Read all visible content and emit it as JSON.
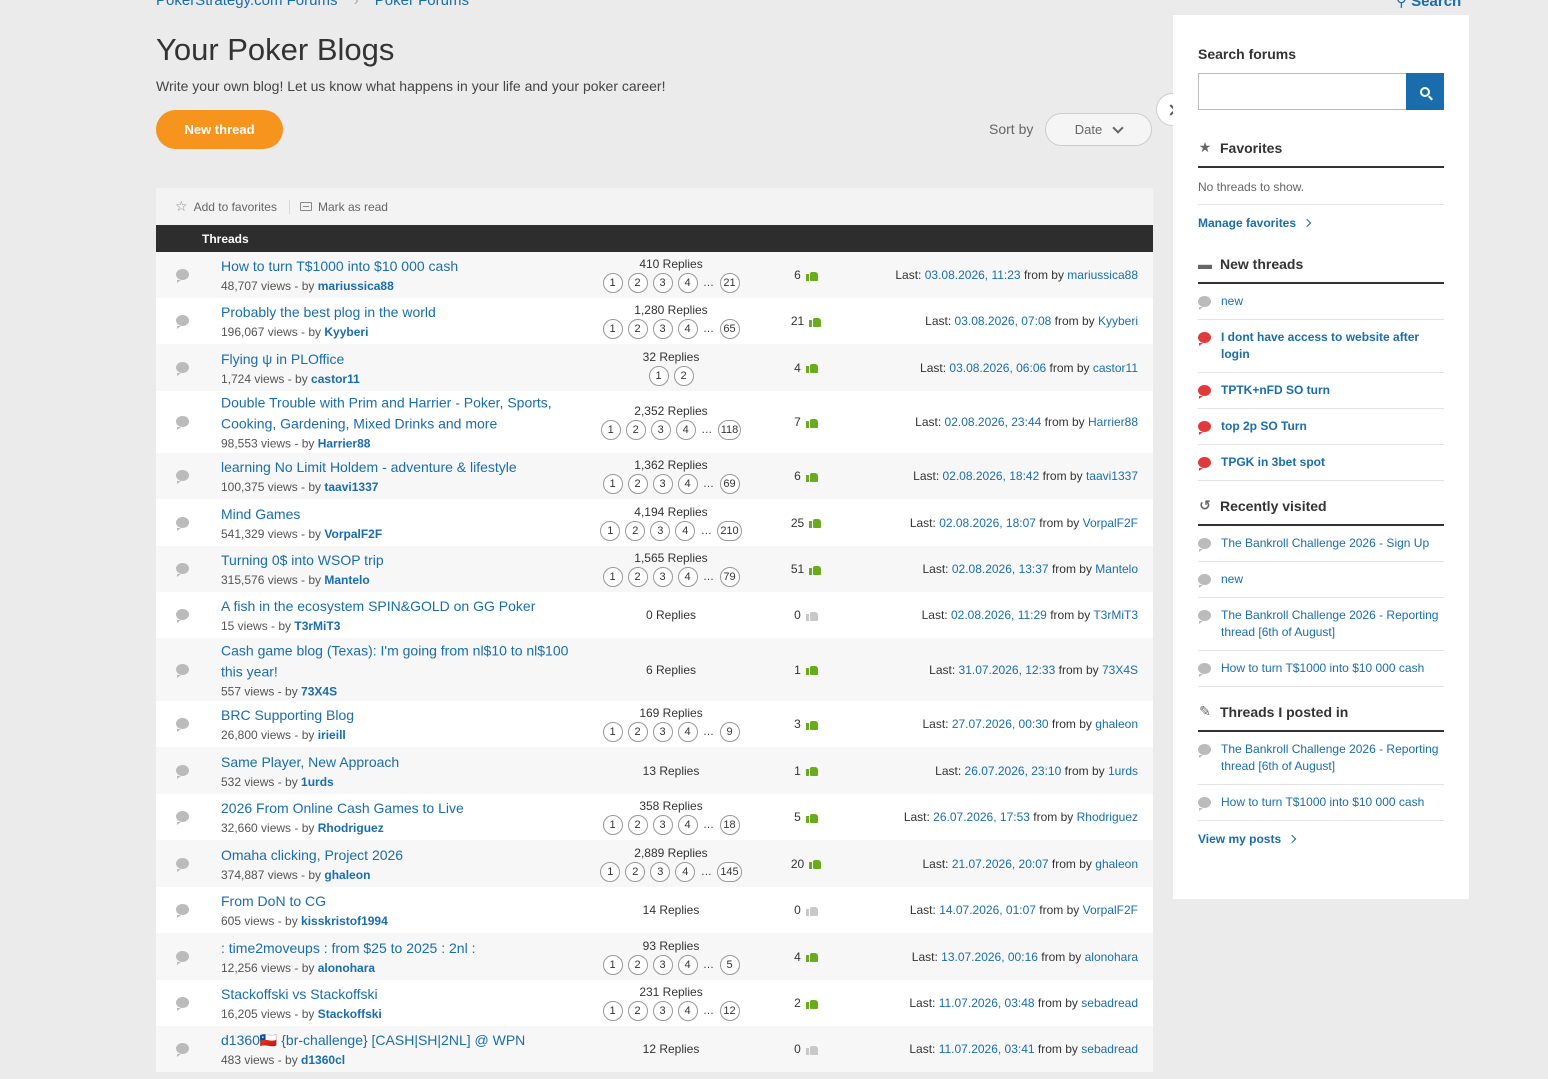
{
  "breadcrumb": [
    "PokerStrategy.com Forums",
    "Poker Forums"
  ],
  "top_search_label": "Search",
  "page": {
    "title": "Your Poker Blogs",
    "description": "Write your own blog! Let us know what happens in your life and your poker career!",
    "new_thread_label": "New thread",
    "sort_label": "Sort by",
    "sort_value": "Date"
  },
  "toolbar": {
    "add_favorites": "Add to favorites",
    "mark_read": "Mark as read"
  },
  "table": {
    "header": "Threads",
    "rows": [
      {
        "title": "How to turn T$1000 into $10 000 cash",
        "views": "48,707 views - by ",
        "author": "mariussica88",
        "replies": "410 Replies",
        "pages": [
          "1",
          "2",
          "3",
          "4",
          "21"
        ],
        "likes": "6",
        "liked": true,
        "last_prefix": "Last: ",
        "last_date": "03.08.2026, 11:23",
        "from": " from by ",
        "last_user": "mariussica88"
      },
      {
        "title": "Probably the best plog in the world",
        "views": "196,067 views - by ",
        "author": "Kyyberi",
        "replies": "1,280 Replies",
        "pages": [
          "1",
          "2",
          "3",
          "4",
          "65"
        ],
        "likes": "21",
        "liked": true,
        "last_prefix": "Last: ",
        "last_date": "03.08.2026, 07:08",
        "from": " from by ",
        "last_user": "Kyyberi"
      },
      {
        "title": "Flying ψ in PLOffice",
        "views": "1,724 views - by ",
        "author": "castor11",
        "replies": "32 Replies",
        "pages": [
          "1",
          "2"
        ],
        "likes": "4",
        "liked": true,
        "last_prefix": "Last: ",
        "last_date": "03.08.2026, 06:06",
        "from": " from by ",
        "last_user": "castor11"
      },
      {
        "title": "Double Trouble with Prim and Harrier - Poker, Sports, Cooking, Gardening, Mixed Drinks and more",
        "views": "98,553 views - by ",
        "author": "Harrier88",
        "replies": "2,352 Replies",
        "pages": [
          "1",
          "2",
          "3",
          "4",
          "118"
        ],
        "likes": "7",
        "liked": true,
        "last_prefix": "Last: ",
        "last_date": "02.08.2026, 23:44",
        "from": " from by ",
        "last_user": "Harrier88"
      },
      {
        "title": "learning No Limit Holdem - adventure & lifestyle",
        "views": "100,375 views - by ",
        "author": "taavi1337",
        "replies": "1,362 Replies",
        "pages": [
          "1",
          "2",
          "3",
          "4",
          "69"
        ],
        "likes": "6",
        "liked": true,
        "last_prefix": "Last: ",
        "last_date": "02.08.2026, 18:42",
        "from": " from by ",
        "last_user": "taavi1337"
      },
      {
        "title": "Mind Games",
        "views": "541,329 views - by ",
        "author": "VorpalF2F",
        "replies": "4,194 Replies",
        "pages": [
          "1",
          "2",
          "3",
          "4",
          "210"
        ],
        "likes": "25",
        "liked": true,
        "last_prefix": "Last: ",
        "last_date": "02.08.2026, 18:07",
        "from": " from by ",
        "last_user": "VorpalF2F"
      },
      {
        "title": "Turning 0$ into WSOP trip",
        "views": "315,576 views - by ",
        "author": "Mantelo",
        "replies": "1,565 Replies",
        "pages": [
          "1",
          "2",
          "3",
          "4",
          "79"
        ],
        "likes": "51",
        "liked": true,
        "last_prefix": "Last: ",
        "last_date": "02.08.2026, 13:37",
        "from": " from by ",
        "last_user": "Mantelo"
      },
      {
        "title": "A fish in the ecosystem SPIN&GOLD on GG Poker",
        "views": "15 views - by ",
        "author": "T3rMiT3",
        "replies": "0 Replies",
        "pages": [],
        "likes": "0",
        "liked": false,
        "last_prefix": "Last: ",
        "last_date": "02.08.2026, 11:29",
        "from": " from by ",
        "last_user": "T3rMiT3"
      },
      {
        "title": "Cash game blog (Texas): I'm going from nl$10 to nl$100 this year!",
        "views": "557 views - by ",
        "author": "73X4S",
        "replies": "6 Replies",
        "pages": [],
        "likes": "1",
        "liked": true,
        "last_prefix": "Last: ",
        "last_date": "31.07.2026, 12:33",
        "from": " from by ",
        "last_user": "73X4S"
      },
      {
        "title": "BRC Supporting Blog",
        "views": "26,800 views - by ",
        "author": "irieill",
        "replies": "169 Replies",
        "pages": [
          "1",
          "2",
          "3",
          "4",
          "9"
        ],
        "likes": "3",
        "liked": true,
        "last_prefix": "Last: ",
        "last_date": "27.07.2026, 00:30",
        "from": " from by ",
        "last_user": "ghaleon"
      },
      {
        "title": "Same Player, New Approach",
        "views": "532 views - by ",
        "author": "1urds",
        "replies": "13 Replies",
        "pages": [],
        "likes": "1",
        "liked": true,
        "last_prefix": "Last: ",
        "last_date": "26.07.2026, 23:10",
        "from": " from by ",
        "last_user": "1urds"
      },
      {
        "title": "2026 From Online Cash Games to Live",
        "views": "32,660 views - by ",
        "author": "Rhodriguez",
        "replies": "358 Replies",
        "pages": [
          "1",
          "2",
          "3",
          "4",
          "18"
        ],
        "likes": "5",
        "liked": true,
        "last_prefix": "Last: ",
        "last_date": "26.07.2026, 17:53",
        "from": " from by ",
        "last_user": "Rhodriguez"
      },
      {
        "title": "Omaha clicking, Project 2026",
        "views": "374,887 views - by ",
        "author": "ghaleon",
        "replies": "2,889 Replies",
        "pages": [
          "1",
          "2",
          "3",
          "4",
          "145"
        ],
        "likes": "20",
        "liked": true,
        "last_prefix": "Last: ",
        "last_date": "21.07.2026, 20:07",
        "from": " from by ",
        "last_user": "ghaleon"
      },
      {
        "title": "From DoN to CG",
        "views": "605 views - by ",
        "author": "kisskristof1994",
        "replies": "14 Replies",
        "pages": [],
        "likes": "0",
        "liked": false,
        "last_prefix": "Last: ",
        "last_date": "14.07.2026, 01:07",
        "from": " from by ",
        "last_user": "VorpalF2F"
      },
      {
        "title": ": time2moveups : from $25 to 2025 : 2nl :",
        "views": "12,256 views - by ",
        "author": "alonohara",
        "replies": "93 Replies",
        "pages": [
          "1",
          "2",
          "3",
          "4",
          "5"
        ],
        "likes": "4",
        "liked": true,
        "last_prefix": "Last: ",
        "last_date": "13.07.2026, 00:16",
        "from": " from by ",
        "last_user": "alonohara"
      },
      {
        "title": "Stackoffski vs Stackoffski",
        "views": "16,205 views - by ",
        "author": "Stackoffski",
        "replies": "231 Replies",
        "pages": [
          "1",
          "2",
          "3",
          "4",
          "12"
        ],
        "likes": "2",
        "liked": true,
        "last_prefix": "Last: ",
        "last_date": "11.07.2026, 03:48",
        "from": " from by ",
        "last_user": "sebadread"
      },
      {
        "title": "d1360🇨🇱 {br-challenge} [CASH|SH|2NL] @ WPN",
        "views": "483 views - by ",
        "author": "d1360cl",
        "replies": "12 Replies",
        "pages": [],
        "likes": "0",
        "liked": false,
        "last_prefix": "Last: ",
        "last_date": "11.07.2026, 03:41",
        "from": " from by ",
        "last_user": "sebadread"
      }
    ]
  },
  "sidebar": {
    "search_label": "Search forums",
    "search_value": "",
    "favorites": {
      "title": "Favorites",
      "empty": "No threads to show.",
      "manage": "Manage favorites"
    },
    "new_threads": {
      "title": "New threads",
      "items": [
        {
          "label": "new",
          "hot": false
        },
        {
          "label": "I dont have access to website after login",
          "hot": true
        },
        {
          "label": "TPTK+nFD SO turn",
          "hot": true
        },
        {
          "label": "top 2p SO Turn",
          "hot": true
        },
        {
          "label": "TPGK in 3bet spot",
          "hot": true
        }
      ]
    },
    "recently_visited": {
      "title": "Recently visited",
      "items": [
        "The Bankroll Challenge 2026 - Sign Up",
        "new",
        "The Bankroll Challenge 2026 - Reporting thread [6th of August]",
        "How to turn T$1000 into $10 000 cash"
      ]
    },
    "posted_in": {
      "title": "Threads I posted in",
      "items": [
        "The Bankroll Challenge 2026 - Reporting thread [6th of August]",
        "How to turn T$1000 into $10 000 cash"
      ],
      "view_posts": "View my posts"
    }
  },
  "colors": {
    "accent": "#f7941d",
    "link": "#1a6dad",
    "like_green": "#6aab1e",
    "hot_red": "#e03a3a",
    "header_dark": "#2d2d2d"
  }
}
